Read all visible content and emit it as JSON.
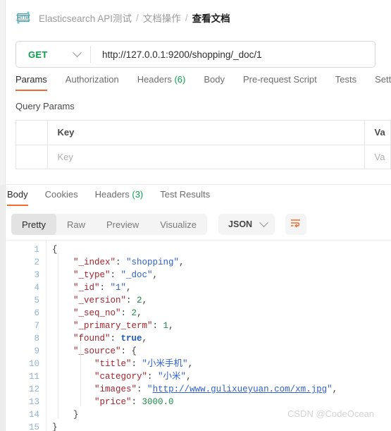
{
  "breadcrumb": {
    "icon": "http-request-icon",
    "collection": "Elasticsearch API测试",
    "folder": "文档操作",
    "request": "查看文档",
    "separator": "/"
  },
  "request_bar": {
    "method": "GET",
    "method_icon": "chevron-down-icon",
    "url": "http://127.0.0.1:9200/shopping/_doc/1"
  },
  "request_tabs": [
    {
      "label": "Params",
      "active": true
    },
    {
      "label": "Authorization",
      "active": false
    },
    {
      "label": "Headers",
      "count": "(6)",
      "active": false
    },
    {
      "label": "Body",
      "active": false
    },
    {
      "label": "Pre-request Script",
      "active": false
    },
    {
      "label": "Tests",
      "active": false
    },
    {
      "label": "Settin",
      "active": false
    }
  ],
  "query_params": {
    "title": "Query Params",
    "headers": {
      "key": "Key",
      "value": "Va"
    },
    "rows": [
      {
        "key_placeholder": "Key",
        "value_placeholder": "Va"
      }
    ]
  },
  "response_tabs": [
    {
      "label": "Body",
      "active": true
    },
    {
      "label": "Cookies",
      "active": false
    },
    {
      "label": "Headers",
      "count": "(3)",
      "active": false
    },
    {
      "label": "Test Results",
      "active": false
    }
  ],
  "format_toolbar": {
    "views": [
      {
        "label": "Pretty",
        "active": true
      },
      {
        "label": "Raw",
        "active": false
      },
      {
        "label": "Preview",
        "active": false
      },
      {
        "label": "Visualize",
        "active": false
      }
    ],
    "language": "JSON",
    "language_icon": "chevron-down-icon",
    "wrap_icon": "word-wrap-icon"
  },
  "response_body": {
    "line_numbers": [
      "1",
      "2",
      "3",
      "4",
      "5",
      "6",
      "7",
      "8",
      "9",
      "10",
      "11",
      "12",
      "13",
      "14",
      "15"
    ],
    "lines": [
      {
        "n": "1",
        "segs": [
          {
            "t": "{",
            "c": "p"
          }
        ]
      },
      {
        "n": "2",
        "segs": [
          {
            "t": "    \"_index\"",
            "c": "k"
          },
          {
            "t": ": ",
            "c": "p"
          },
          {
            "t": "\"shopping\"",
            "c": "s"
          },
          {
            "t": ",",
            "c": "p"
          }
        ]
      },
      {
        "n": "3",
        "segs": [
          {
            "t": "    \"_type\"",
            "c": "k"
          },
          {
            "t": ": ",
            "c": "p"
          },
          {
            "t": "\"_doc\"",
            "c": "s"
          },
          {
            "t": ",",
            "c": "p"
          }
        ]
      },
      {
        "n": "4",
        "segs": [
          {
            "t": "    \"_id\"",
            "c": "k"
          },
          {
            "t": ": ",
            "c": "p"
          },
          {
            "t": "\"1\"",
            "c": "s"
          },
          {
            "t": ",",
            "c": "p"
          }
        ]
      },
      {
        "n": "5",
        "segs": [
          {
            "t": "    \"_version\"",
            "c": "k"
          },
          {
            "t": ": ",
            "c": "p"
          },
          {
            "t": "2",
            "c": "n"
          },
          {
            "t": ",",
            "c": "p"
          }
        ]
      },
      {
        "n": "6",
        "segs": [
          {
            "t": "    \"_seq_no\"",
            "c": "k"
          },
          {
            "t": ": ",
            "c": "p"
          },
          {
            "t": "2",
            "c": "n"
          },
          {
            "t": ",",
            "c": "p"
          }
        ]
      },
      {
        "n": "7",
        "segs": [
          {
            "t": "    \"_primary_term\"",
            "c": "k"
          },
          {
            "t": ": ",
            "c": "p"
          },
          {
            "t": "1",
            "c": "n"
          },
          {
            "t": ",",
            "c": "p"
          }
        ]
      },
      {
        "n": "8",
        "segs": [
          {
            "t": "    \"found\"",
            "c": "k"
          },
          {
            "t": ": ",
            "c": "p"
          },
          {
            "t": "true",
            "c": "b"
          },
          {
            "t": ",",
            "c": "p"
          }
        ]
      },
      {
        "n": "9",
        "segs": [
          {
            "t": "    \"_source\"",
            "c": "k"
          },
          {
            "t": ": {",
            "c": "p"
          }
        ]
      },
      {
        "n": "10",
        "segs": [
          {
            "t": "        \"title\"",
            "c": "k"
          },
          {
            "t": ": ",
            "c": "p"
          },
          {
            "t": "\"小米手机\"",
            "c": "s"
          },
          {
            "t": ",",
            "c": "p"
          }
        ]
      },
      {
        "n": "11",
        "segs": [
          {
            "t": "        \"category\"",
            "c": "k"
          },
          {
            "t": ": ",
            "c": "p"
          },
          {
            "t": "\"小米\"",
            "c": "s"
          },
          {
            "t": ",",
            "c": "p"
          }
        ]
      },
      {
        "n": "12",
        "segs": [
          {
            "t": "        \"images\"",
            "c": "k"
          },
          {
            "t": ": ",
            "c": "p"
          },
          {
            "t": "\"",
            "c": "s"
          },
          {
            "t": "http://www.gulixueyuan.com/xm.jpg",
            "c": "lnk"
          },
          {
            "t": "\"",
            "c": "s"
          },
          {
            "t": ",",
            "c": "p"
          }
        ]
      },
      {
        "n": "13",
        "segs": [
          {
            "t": "        \"price\"",
            "c": "k"
          },
          {
            "t": ": ",
            "c": "p"
          },
          {
            "t": "3000.0",
            "c": "n"
          }
        ]
      },
      {
        "n": "14",
        "segs": [
          {
            "t": "    }",
            "c": "p"
          }
        ]
      },
      {
        "n": "15",
        "segs": [
          {
            "t": "}",
            "c": "p"
          }
        ]
      }
    ]
  },
  "watermark": "CSDN @CodeOcean",
  "colors": {
    "accent_orange": "#ef6c2e",
    "method_green": "#0aa14b",
    "json_key": "#a3232b",
    "json_string": "#2f5fd0",
    "json_number": "#1a8a4a",
    "json_boolean": "#1a55c4",
    "line_number": "#8fb4d6"
  }
}
